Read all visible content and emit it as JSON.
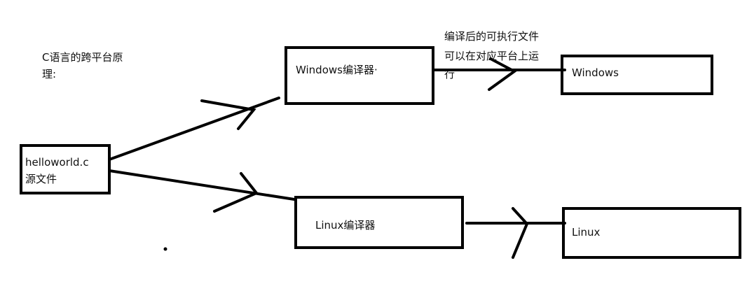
{
  "title": {
    "line1": "C语言的跨平台原",
    "line2": "理:"
  },
  "nodes": {
    "source": {
      "line1": "helloworld.c",
      "line2": "源文件"
    },
    "win_compiler": {
      "label": "Windows编译器·"
    },
    "linux_compiler": {
      "label": "Linux编译器"
    },
    "win_platform": {
      "label": "Windows"
    },
    "linux_platform": {
      "label": "Linux"
    }
  },
  "annotation": {
    "line1": "编译后的可执行文件",
    "line2": "可以在对应平台上运",
    "line3": "行"
  }
}
